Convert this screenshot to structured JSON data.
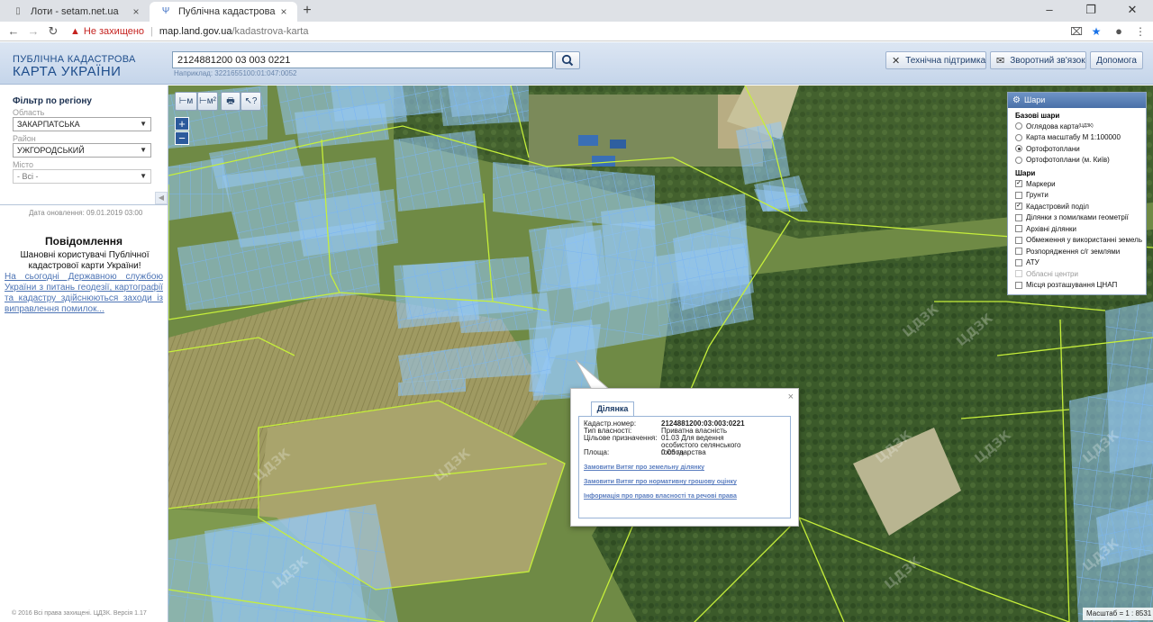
{
  "browser": {
    "tabs": [
      {
        "title": "Лоти - setam.net.ua",
        "active": false
      },
      {
        "title": "Публічна кадастрова карта Укр…",
        "active": true
      }
    ],
    "url_warning": "Не захищено",
    "url_host": "map.land.gov.ua",
    "url_path": "/kadastrova-karta"
  },
  "header": {
    "brand_line1": "ПУБЛІЧНА КАДАСТРОВА",
    "brand_line2": "КАРТА УКРАЇНИ",
    "search_value": "2124881200 03 003 0221",
    "search_hint": "Наприклад: 3221655100:01:047:0052",
    "buttons": {
      "support": "Технічна підтримка",
      "feedback": "Зворотний зв'язок",
      "help": "Допомога"
    }
  },
  "filter": {
    "title": "Фільтр по регіону",
    "oblast_label": "Область",
    "oblast_value": "ЗАКАРПАТСЬКА",
    "raion_label": "Район",
    "raion_value": "УЖГОРОДСЬКИЙ",
    "misto_label": "Місто",
    "misto_value": "- Всі -"
  },
  "update_date": "Дата оновлення: 09.01.2019 03:00",
  "news": {
    "title": "Повідомлення",
    "greeting": "Шановні користувачі Публічної кадастрової карти України!",
    "link": "На сьогодні Державною службою України з питань геодезії, картографії та кадастру здійснюються заходи із виправлення помилок..."
  },
  "copyright": "© 2016 Всі права захищені. ЦДЗК. Версія 1.17",
  "map_tools": {
    "measure_line": "⊢м",
    "measure_area": "⊢м²",
    "print": "🖶",
    "identify": "↖?",
    "zoom_in": "+",
    "zoom_out": "−"
  },
  "layers": {
    "title": "Шари",
    "base_title": "Базові шари",
    "base": [
      {
        "label": "Оглядова карта",
        "sup": "(ЦДЗК)",
        "on": false
      },
      {
        "label": "Карта масштабу М 1:100000",
        "on": false
      },
      {
        "label": "Ортофотоплани",
        "on": true
      },
      {
        "label": "Ортофотоплани (м. Київ)",
        "on": false
      }
    ],
    "over_title": "Шари",
    "overlays": [
      {
        "label": "Маркери",
        "on": true,
        "disabled": false
      },
      {
        "label": "Грунти",
        "on": false,
        "disabled": false
      },
      {
        "label": "Кадастровий поділ",
        "on": true,
        "disabled": false
      },
      {
        "label": "Ділянки з помилками геометрії",
        "on": false,
        "disabled": false
      },
      {
        "label": "Архівні ділянки",
        "on": false,
        "disabled": false
      },
      {
        "label": "Обмеження у використанні земель",
        "on": false,
        "disabled": false
      },
      {
        "label": "Розпорядження с/г землями",
        "on": false,
        "disabled": false
      },
      {
        "label": "АТУ",
        "on": false,
        "disabled": false
      },
      {
        "label": "Обласні центри",
        "on": false,
        "disabled": true
      },
      {
        "label": "Місця розташування ЦНАП",
        "on": false,
        "disabled": false
      }
    ]
  },
  "popup": {
    "tab": "Ділянка",
    "rows": [
      {
        "k": "Кадастр.номер:",
        "v": "2124881200:03:003:0221"
      },
      {
        "k": "Тип власності:",
        "v": "Приватна власність"
      },
      {
        "k": "Цільове призначення:",
        "v": "01.03 Для ведення особистого селянського господарства"
      },
      {
        "k": "Площа:",
        "v": "0.06 га"
      }
    ],
    "links": [
      "Замовити Витяг про земельну ділянку",
      "Замовити Витяг про нормативну грошову оцінку",
      "Інформація про право власності та речові права"
    ]
  },
  "scale": "Масштаб = 1 : 8531",
  "icons": {
    "page": "page-icon",
    "trident": "trident-icon",
    "close": "close-icon",
    "plus": "plus-icon",
    "back": "back-arrow-icon",
    "forward": "forward-arrow-icon",
    "reload": "reload-icon",
    "warning": "warning-icon",
    "translate": "translate-icon",
    "star": "star-icon",
    "account": "account-icon",
    "menu": "menu-icon",
    "search": "search-icon",
    "tools": "tools-icon",
    "mail": "mail-icon",
    "gear": "gear-icon"
  }
}
